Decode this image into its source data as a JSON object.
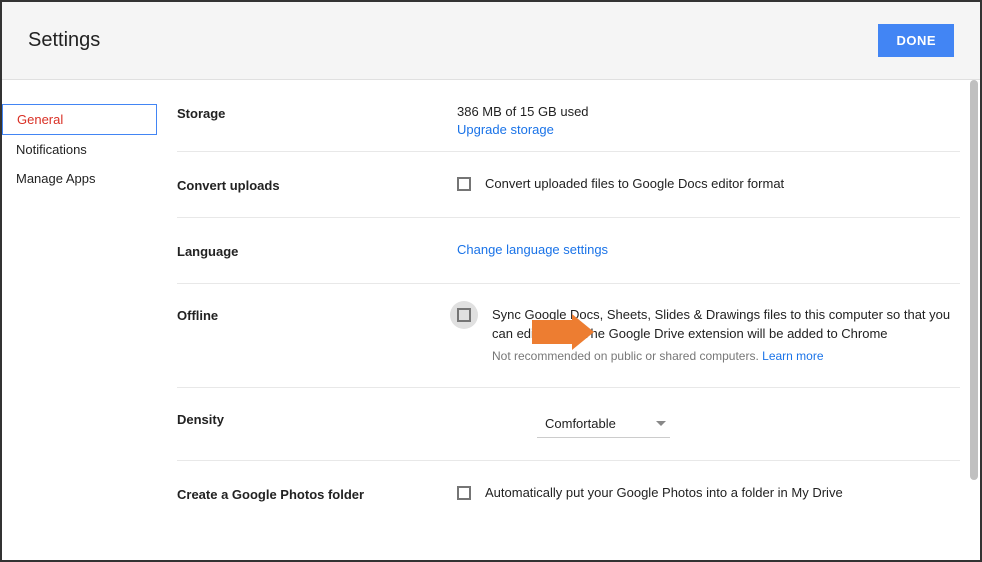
{
  "header": {
    "title": "Settings",
    "done": "DONE"
  },
  "sidebar": {
    "items": [
      {
        "label": "General"
      },
      {
        "label": "Notifications"
      },
      {
        "label": "Manage Apps"
      }
    ]
  },
  "sections": {
    "storage": {
      "label": "Storage",
      "usage": "386 MB of 15 GB used",
      "upgrade": "Upgrade storage"
    },
    "convert": {
      "label": "Convert uploads",
      "text": "Convert uploaded files to Google Docs editor format"
    },
    "language": {
      "label": "Language",
      "link": "Change language settings"
    },
    "offline": {
      "label": "Offline",
      "text": "Sync Google Docs, Sheets, Slides & Drawings files to this computer so that you can edit offline. The Google Drive extension will be added to Chrome",
      "subtext": "Not recommended on public or shared computers. ",
      "learn": "Learn more"
    },
    "density": {
      "label": "Density",
      "value": "Comfortable"
    },
    "photos": {
      "label": "Create a Google Photos folder",
      "text": "Automatically put your Google Photos into a folder in My Drive"
    }
  }
}
